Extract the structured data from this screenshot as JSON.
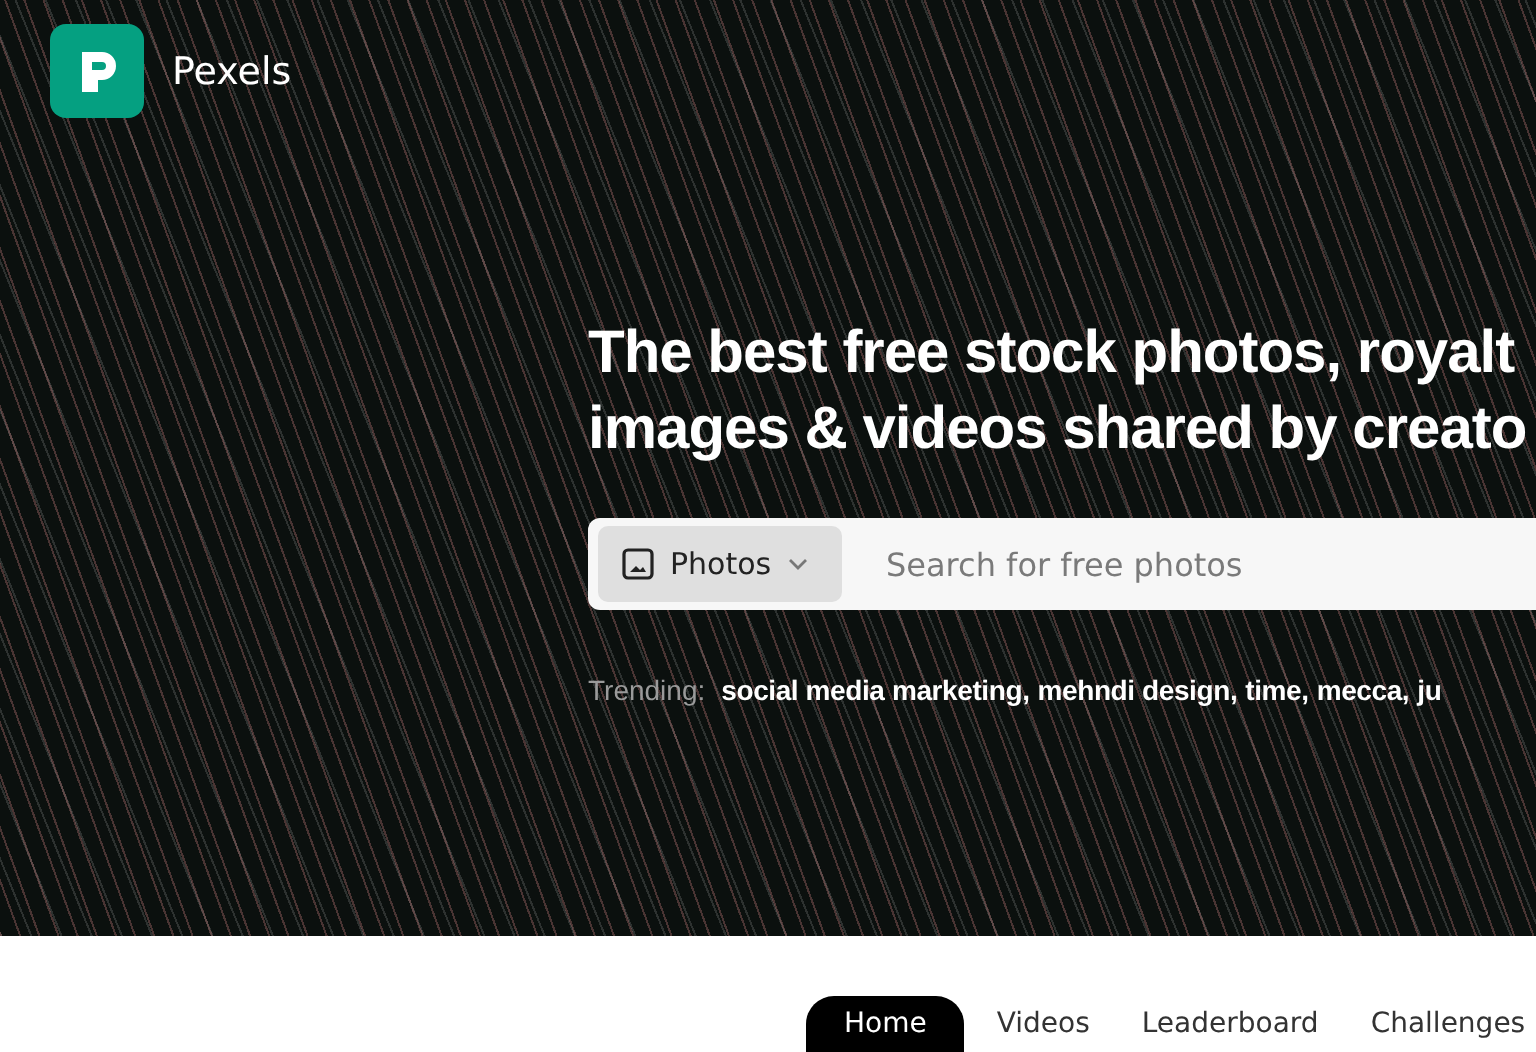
{
  "brand": {
    "name": "Pexels"
  },
  "hero": {
    "headline": [
      "The best free stock photos, royalt",
      "images & videos shared by creato"
    ],
    "search": {
      "media_type": "Photos",
      "placeholder": "Search for free photos"
    },
    "trending": {
      "label": "Trending:",
      "items": [
        "social media marketing,",
        "mehndi design,",
        "time,",
        "mecca,",
        "ju"
      ]
    }
  },
  "tabs": [
    {
      "label": "Home",
      "selected": true
    },
    {
      "label": "Videos",
      "selected": false
    },
    {
      "label": "Leaderboard",
      "selected": false
    },
    {
      "label": "Challenges",
      "selected": false
    }
  ]
}
